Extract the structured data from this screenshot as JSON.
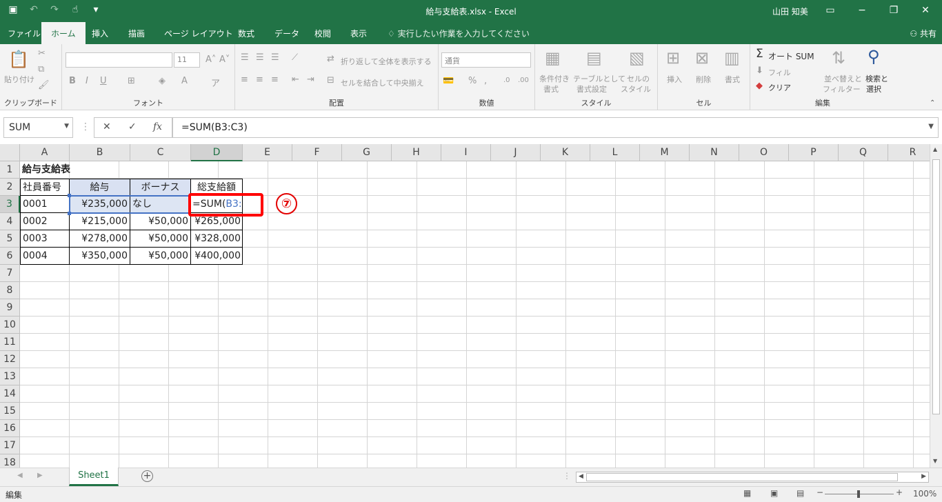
{
  "app": {
    "title": "給与支給表.xlsx  -  Excel",
    "user": "山田 知美"
  },
  "tabs": [
    "ファイル",
    "ホーム",
    "挿入",
    "描画",
    "ページ レイアウト",
    "数式",
    "データ",
    "校閲",
    "表示"
  ],
  "tell_me": "実行したい作業を入力してください",
  "share": "共有",
  "ribbon": {
    "clipboard": {
      "paste": "貼り付け",
      "label": "クリップボード"
    },
    "font": {
      "size": "11",
      "label": "フォント"
    },
    "alignment": {
      "wrap": "折り返して全体を表示する",
      "merge": "セルを結合して中央揃え",
      "label": "配置"
    },
    "number": {
      "format": "通貨",
      "label": "数値"
    },
    "styles": {
      "conditional_1": "条件付き",
      "conditional_2": "書式",
      "table_1": "テーブルとして",
      "table_2": "書式設定",
      "cell_1": "セルの",
      "cell_2": "スタイル",
      "label": "スタイル"
    },
    "cells": {
      "insert": "挿入",
      "delete": "削除",
      "format": "書式",
      "label": "セル"
    },
    "editing": {
      "autosum": "オート SUM",
      "fill": "フィル",
      "clear": "クリア",
      "sort_1": "並べ替えと",
      "sort_2": "フィルター",
      "find_1": "検索と",
      "find_2": "選択",
      "label": "編集"
    }
  },
  "formula_bar": {
    "name_box": "SUM",
    "formula": "=SUM(B3:C3)"
  },
  "columns": [
    "A",
    "B",
    "C",
    "D",
    "E",
    "F",
    "G",
    "H",
    "I",
    "J",
    "K",
    "L",
    "M",
    "N",
    "O",
    "P",
    "Q",
    "R"
  ],
  "rows": [
    "1",
    "2",
    "3",
    "4",
    "5",
    "6",
    "7",
    "8",
    "9",
    "10",
    "11",
    "12",
    "13",
    "14",
    "15",
    "16",
    "17",
    "18"
  ],
  "sheet": {
    "title": "給与支給表",
    "headers": [
      "社員番号",
      "給与",
      "ボーナス",
      "総支給額"
    ],
    "data": [
      [
        "0001",
        "¥235,000",
        "なし",
        ""
      ],
      [
        "0002",
        "¥215,000",
        "¥50,000",
        "¥265,000"
      ],
      [
        "0003",
        "¥278,000",
        "¥50,000",
        "¥328,000"
      ],
      [
        "0004",
        "¥350,000",
        "¥50,000",
        "¥400,000"
      ]
    ],
    "editing_prefix": "=SUM(",
    "editing_ref": "B3:C3",
    "editing_suffix": ")"
  },
  "annotation": "⑦",
  "sheet_tab": "Sheet1",
  "status": {
    "mode": "編集",
    "zoom": "100%"
  },
  "colors": {
    "accent": "#217346",
    "highlight": "#ff0000",
    "reference": "#4472c4"
  }
}
